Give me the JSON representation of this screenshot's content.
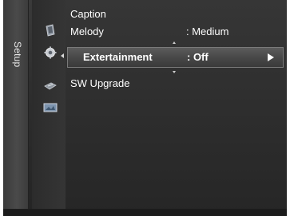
{
  "menu": {
    "category_label": "Setup",
    "items": [
      {
        "label": "Caption",
        "value": ""
      },
      {
        "label": "Melody",
        "value": ": Medium"
      },
      {
        "label": "Extertainment",
        "value": ": Off"
      },
      {
        "label": "SW Upgrade",
        "value": ""
      }
    ],
    "selected_index": 2
  },
  "icons": [
    "tv-icon",
    "gear-icon",
    "satellite-icon",
    "screen-icon"
  ],
  "colors": {
    "background": "#2e2e2e",
    "highlight": "#4a4a4a",
    "text": "#ffffff"
  }
}
